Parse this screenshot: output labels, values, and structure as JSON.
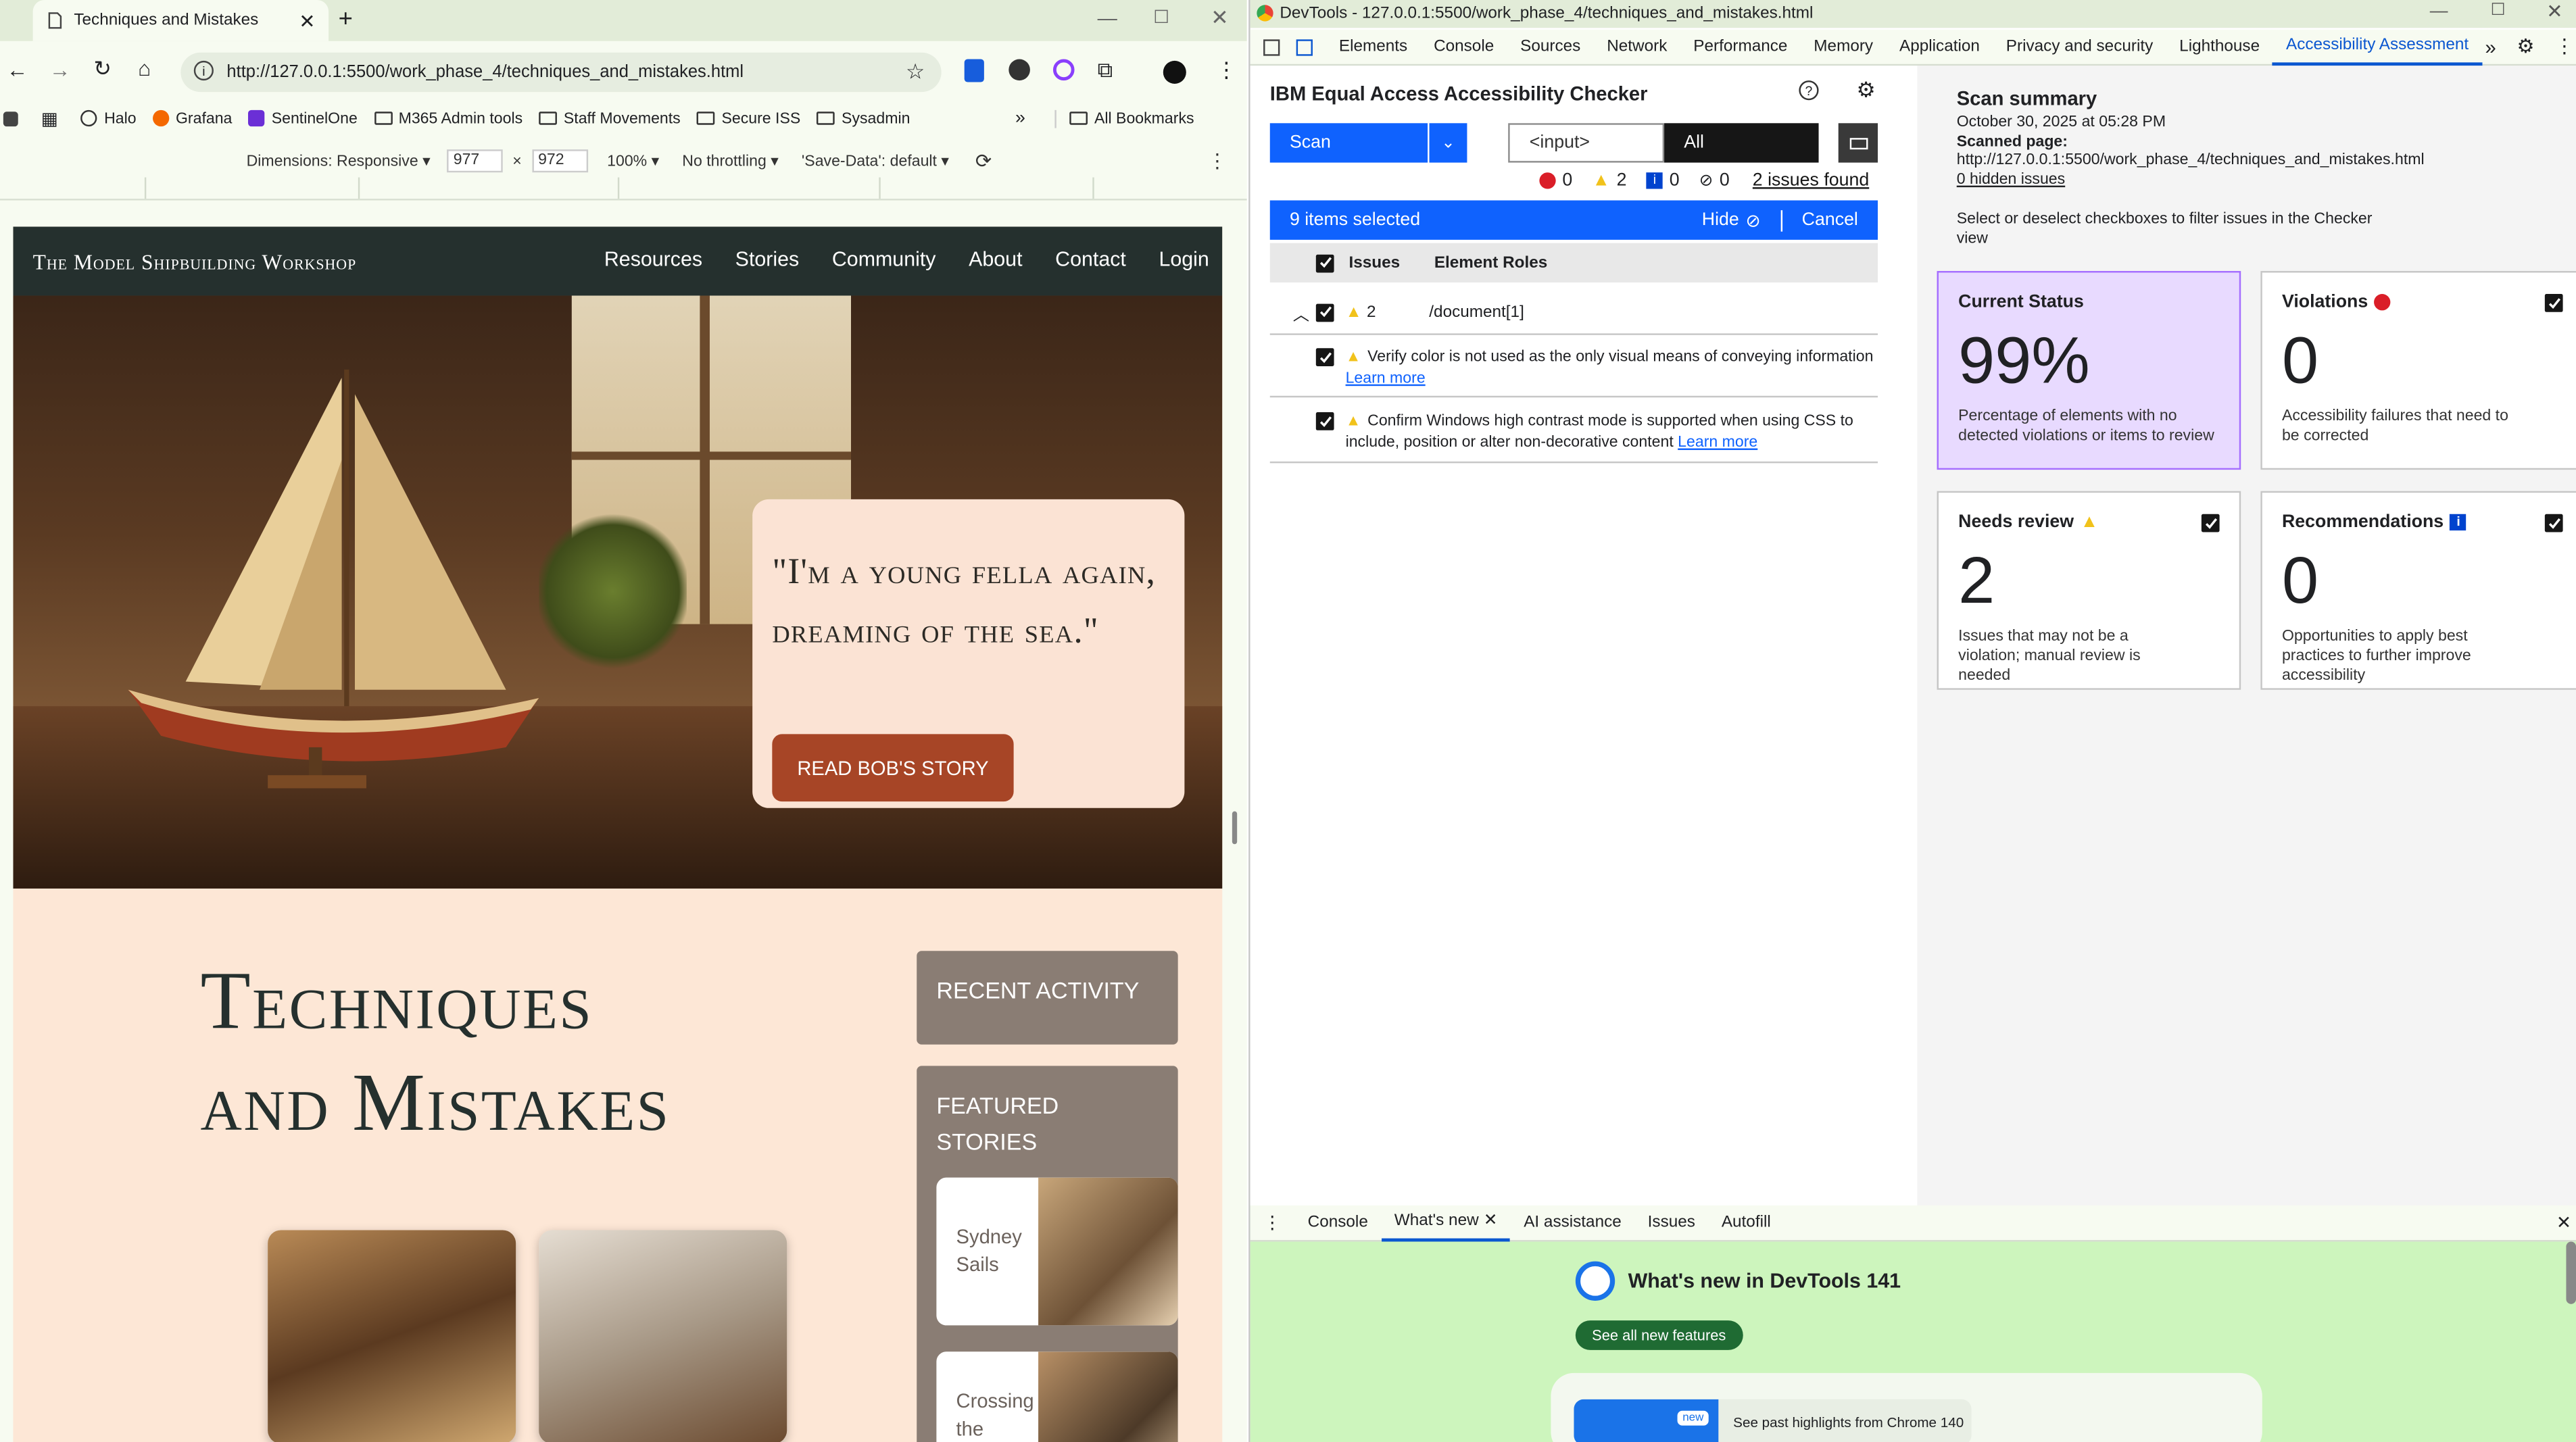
{
  "browser": {
    "tab_title": "Techniques and Mistakes",
    "url": "http://127.0.0.1:5500/work_phase_4/techniques_and_mistakes.html",
    "bookmarks": [
      "Halo",
      "Grafana",
      "SentinelOne",
      "M365 Admin tools",
      "Staff Movements",
      "Secure ISS",
      "Sysadmin"
    ],
    "all_bookmarks": "All Bookmarks",
    "device_toolbar": {
      "dimensions_label": "Dimensions: Responsive",
      "width": "977",
      "times": "×",
      "height": "972",
      "zoom": "100%",
      "throttle": "No throttling",
      "save_data": "'Save-Data': default"
    }
  },
  "site": {
    "brand": "The Model Shipbuilding Workshop",
    "nav": [
      "Resources",
      "Stories",
      "Community",
      "About",
      "Contact",
      "Login"
    ],
    "quote": "\"I'm a young fella again, dreaming of the sea.\"",
    "cta": "READ BOB'S STORY",
    "title_line1": "Techniques",
    "title_line2": "and Mistakes",
    "recent_activity": "RECENT ACTIVITY",
    "featured_stories": "FEATURED STORIES",
    "story1": "Sydney Sails",
    "story2": "Crossing the"
  },
  "devtools": {
    "window_title": "DevTools - 127.0.0.1:5500/work_phase_4/techniques_and_mistakes.html",
    "tabs": [
      "Elements",
      "Console",
      "Sources",
      "Network",
      "Performance",
      "Memory",
      "Application",
      "Privacy and security",
      "Lighthouse",
      "Accessibility Assessment"
    ],
    "more_tabs": "»",
    "checker": {
      "title": "IBM Equal Access Accessibility Checker",
      "scan_label": "Scan",
      "filter_placeholder": "<input>",
      "filter_value": "All",
      "counts": {
        "violations": "0",
        "needs_review": "2",
        "recommendations": "0",
        "hidden": "0"
      },
      "issues_found": "2 issues found",
      "selection_text": "9 items selected",
      "hide_label": "Hide",
      "cancel_label": "Cancel",
      "col_issues": "Issues",
      "col_roles": "Element Roles",
      "group_count": "2",
      "group_role": "/document[1]",
      "issues": [
        {
          "text": "Verify color is not used as the only visual means of conveying information",
          "link": "Learn more"
        },
        {
          "text": "Confirm Windows high contrast mode is supported when using CSS to include, position or alter non-decorative content",
          "link": "Learn more"
        }
      ]
    },
    "summary": {
      "title": "Scan summary",
      "date": "October 30, 2025 at 05:28 PM",
      "scanned_label": "Scanned page:",
      "scanned_url": "http://127.0.0.1:5500/work_phase_4/techniques_and_mistakes.html",
      "hidden_issues": "0 hidden issues",
      "hint": "Select or deselect checkboxes to filter issues in the Checker view",
      "tiles": {
        "status": {
          "title": "Current Status",
          "value": "99%",
          "desc": "Percentage of elements with no detected violations or items to review"
        },
        "violations": {
          "title": "Violations",
          "value": "0",
          "desc": "Accessibility failures that need to be corrected"
        },
        "needs_review": {
          "title": "Needs review",
          "value": "2",
          "desc": "Issues that may not be a violation; manual review is needed"
        },
        "recommendations": {
          "title": "Recommendations",
          "value": "0",
          "desc": "Opportunities to apply best practices to further improve accessibility"
        }
      }
    },
    "drawer": {
      "tabs": [
        "Console",
        "What's new",
        "AI assistance",
        "Issues",
        "Autofill"
      ],
      "whats_new_title": "What's new in DevTools 141",
      "see_all": "See all new features",
      "new_badge": "new",
      "past_highlights": "See past highlights from Chrome 140"
    }
  },
  "colors": {
    "accent": "#0f62fe",
    "status_purple": "#e8daff",
    "violation_red": "#da1e28",
    "warning_yellow": "#f1c21b"
  }
}
